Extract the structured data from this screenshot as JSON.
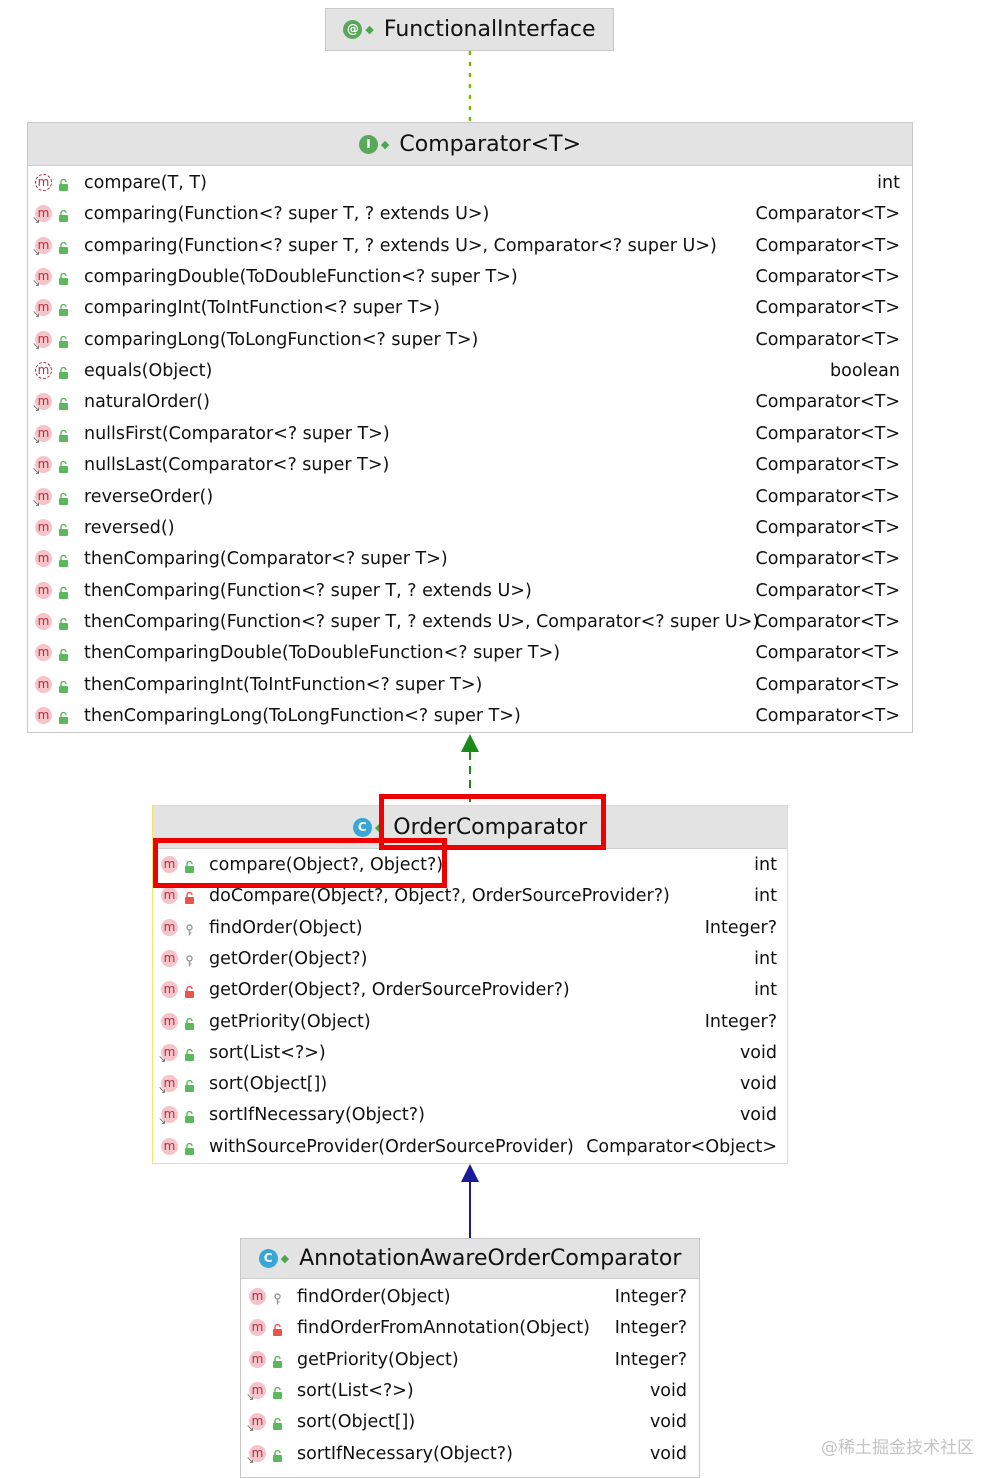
{
  "functional_interface": {
    "name": "FunctionalInterface",
    "icon": "annotation-icon",
    "icon_letter": "@"
  },
  "comparator": {
    "name": "Comparator<T>",
    "icon": "interface-icon",
    "icon_letter": "I",
    "methods": [
      {
        "sig": "compare(T, T)",
        "ret": "int",
        "kind": "abstract"
      },
      {
        "sig": "comparing(Function<? super T, ? extends U>)",
        "ret": "Comparator<T>",
        "kind": "static"
      },
      {
        "sig": "comparing(Function<? super T, ? extends U>, Comparator<? super U>)",
        "ret": "Comparator<T>",
        "kind": "static"
      },
      {
        "sig": "comparingDouble(ToDoubleFunction<? super T>)",
        "ret": "Comparator<T>",
        "kind": "static"
      },
      {
        "sig": "comparingInt(ToIntFunction<? super T>)",
        "ret": "Comparator<T>",
        "kind": "static"
      },
      {
        "sig": "comparingLong(ToLongFunction<? super T>)",
        "ret": "Comparator<T>",
        "kind": "static"
      },
      {
        "sig": "equals(Object)",
        "ret": "boolean",
        "kind": "abstract"
      },
      {
        "sig": "naturalOrder()",
        "ret": "Comparator<T>",
        "kind": "static"
      },
      {
        "sig": "nullsFirst(Comparator<? super T>)",
        "ret": "Comparator<T>",
        "kind": "static"
      },
      {
        "sig": "nullsLast(Comparator<? super T>)",
        "ret": "Comparator<T>",
        "kind": "static"
      },
      {
        "sig": "reverseOrder()",
        "ret": "Comparator<T>",
        "kind": "static"
      },
      {
        "sig": "reversed()",
        "ret": "Comparator<T>",
        "kind": "method"
      },
      {
        "sig": "thenComparing(Comparator<? super T>)",
        "ret": "Comparator<T>",
        "kind": "method"
      },
      {
        "sig": "thenComparing(Function<? super T, ? extends U>)",
        "ret": "Comparator<T>",
        "kind": "method"
      },
      {
        "sig": "thenComparing(Function<? super T, ? extends U>, Comparator<? super U>)",
        "ret": "Comparator<T>",
        "kind": "method"
      },
      {
        "sig": "thenComparingDouble(ToDoubleFunction<? super T>)",
        "ret": "Comparator<T>",
        "kind": "method"
      },
      {
        "sig": "thenComparingInt(ToIntFunction<? super T>)",
        "ret": "Comparator<T>",
        "kind": "method"
      },
      {
        "sig": "thenComparingLong(ToLongFunction<? super T>)",
        "ret": "Comparator<T>",
        "kind": "method"
      }
    ]
  },
  "order_comparator": {
    "name": "OrderComparator",
    "icon": "class-icon",
    "icon_letter": "C",
    "methods": [
      {
        "sig": "compare(Object?, Object?)",
        "ret": "int",
        "kind": "method",
        "vis": "public"
      },
      {
        "sig": "doCompare(Object?, Object?, OrderSourceProvider?)",
        "ret": "int",
        "kind": "method",
        "vis": "private"
      },
      {
        "sig": "findOrder(Object)",
        "ret": "Integer?",
        "kind": "method",
        "vis": "protected"
      },
      {
        "sig": "getOrder(Object?)",
        "ret": "int",
        "kind": "method",
        "vis": "protected"
      },
      {
        "sig": "getOrder(Object?, OrderSourceProvider?)",
        "ret": "int",
        "kind": "method",
        "vis": "private"
      },
      {
        "sig": "getPriority(Object)",
        "ret": "Integer?",
        "kind": "method",
        "vis": "public"
      },
      {
        "sig": "sort(List<?>)",
        "ret": "void",
        "kind": "static",
        "vis": "public"
      },
      {
        "sig": "sort(Object[])",
        "ret": "void",
        "kind": "static",
        "vis": "public"
      },
      {
        "sig": "sortIfNecessary(Object?)",
        "ret": "void",
        "kind": "static",
        "vis": "public"
      },
      {
        "sig": "withSourceProvider(OrderSourceProvider)",
        "ret": "Comparator<Object>",
        "kind": "method",
        "vis": "public"
      }
    ]
  },
  "annotation_aware": {
    "name": "AnnotationAwareOrderComparator",
    "icon": "class-icon",
    "icon_letter": "C",
    "methods": [
      {
        "sig": "findOrder(Object)",
        "ret": "Integer?",
        "kind": "method",
        "vis": "protected"
      },
      {
        "sig": "findOrderFromAnnotation(Object)",
        "ret": "Integer?",
        "kind": "method",
        "vis": "private"
      },
      {
        "sig": "getPriority(Object)",
        "ret": "Integer?",
        "kind": "method",
        "vis": "public"
      },
      {
        "sig": "sort(List<?>)",
        "ret": "void",
        "kind": "static",
        "vis": "public"
      },
      {
        "sig": "sort(Object[])",
        "ret": "void",
        "kind": "static",
        "vis": "public"
      },
      {
        "sig": "sortIfNecessary(Object?)",
        "ret": "void",
        "kind": "static",
        "vis": "public"
      }
    ]
  },
  "icons": {
    "method_letter": "m"
  },
  "colors": {
    "highlight": "#ee0000",
    "interface_icon": "#5aa85a",
    "class_icon": "#39a7d6",
    "realization_arrow": "#1a8a1a",
    "generalization_arrow": "#1a1a9a"
  },
  "watermark": "@稀土掘金技术社区"
}
